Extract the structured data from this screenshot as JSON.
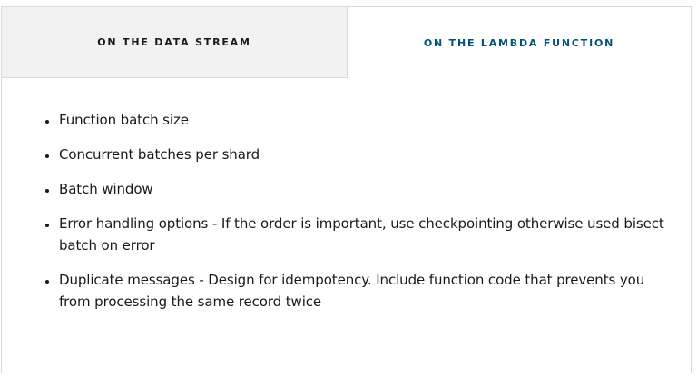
{
  "tabs": [
    {
      "label": "ON THE DATA STREAM",
      "active": false
    },
    {
      "label": "ON THE LAMBDA FUNCTION",
      "active": true
    }
  ],
  "content": {
    "items": [
      "Function batch size",
      "Concurrent batches per shard",
      "Batch window",
      "Error handling options - If the order is important, use checkpointing otherwise used bisect batch on error",
      "Duplicate messages - Design for idempotency. Include function code that prevents you from processing the same record twice"
    ]
  },
  "colors": {
    "active_tab_text": "#005276",
    "inactive_tab_bg": "#f2f2f2",
    "border": "#d5dbdb",
    "body_text": "#16191f"
  }
}
